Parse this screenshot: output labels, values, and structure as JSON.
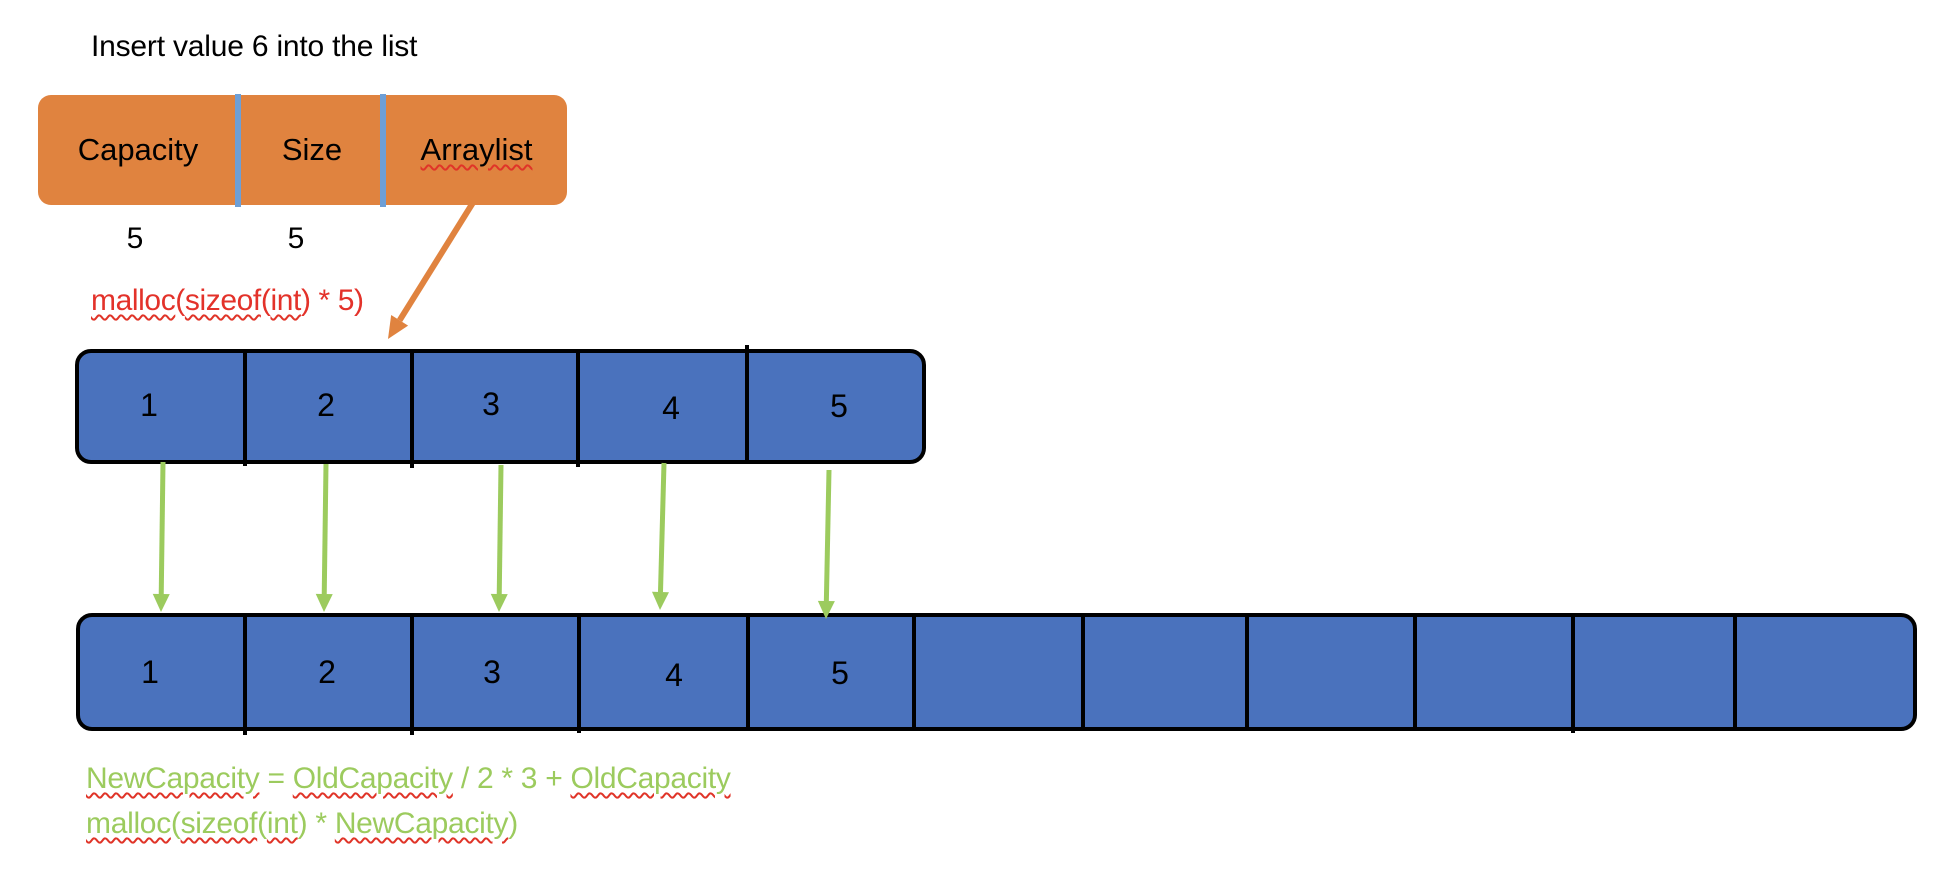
{
  "title": "Insert value 6 into the list",
  "struct": {
    "fields": [
      {
        "label": "Capacity",
        "value": "5"
      },
      {
        "label": "Size",
        "value": "5"
      },
      {
        "label": "Arraylist",
        "value": null
      }
    ]
  },
  "old_array": {
    "malloc_label_parts": [
      "malloc",
      "(",
      "sizeof",
      "(",
      "int",
      ") * 5)"
    ],
    "cells": [
      "1",
      "2",
      "3",
      "4",
      "5"
    ]
  },
  "new_array": {
    "cells": [
      "1",
      "2",
      "3",
      "4",
      "5",
      "",
      "",
      "",
      "",
      "",
      ""
    ]
  },
  "formulas": {
    "line1_parts": [
      "NewCapacity",
      " = ",
      "OldCapacity",
      " / 2 * 3 + ",
      "OldCapacity"
    ],
    "line2_parts": [
      "malloc",
      "(",
      "sizeof",
      "(",
      "int",
      ") * ",
      "NewCapacity",
      ")"
    ]
  },
  "colors": {
    "struct_fill": "#E0833F",
    "struct_divider": "#6E9FD6",
    "array_fill": "#4A72BD",
    "pointer_arrow": "#E0833F",
    "copy_arrow": "#9CCB5E",
    "malloc_text": "#E3322A",
    "formula_text": "#9CCB5E"
  }
}
